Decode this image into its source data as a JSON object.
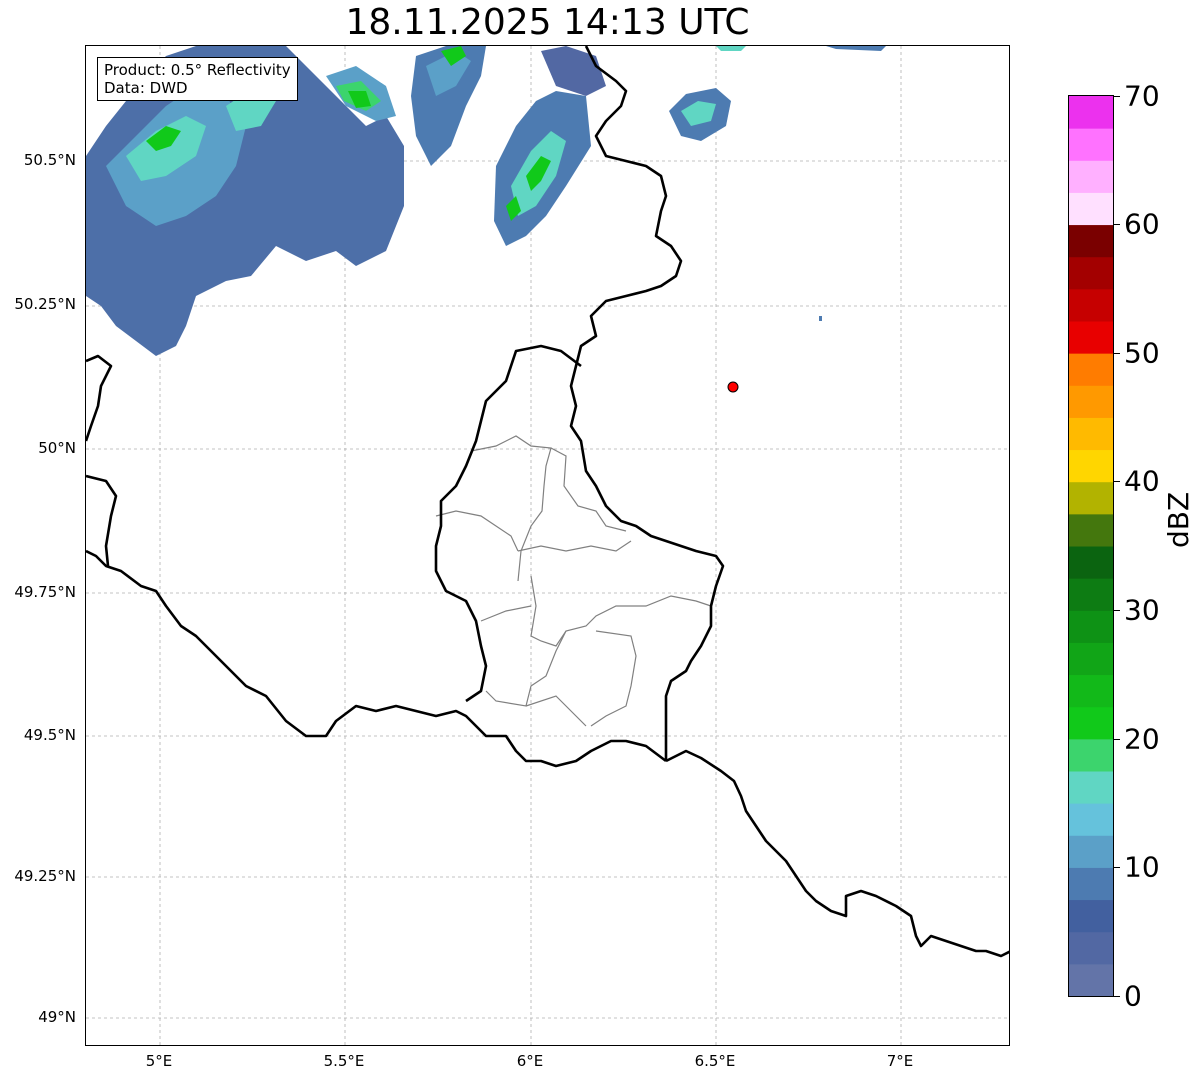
{
  "title": "18.11.2025 14:13 UTC",
  "info": {
    "line1": "Product: 0.5° Reflectivity",
    "line2": "Data: DWD"
  },
  "map": {
    "lat_labels": [
      "50.5°N",
      "50.25°N",
      "50°N",
      "49.75°N",
      "49.5°N",
      "49.25°N",
      "49°N"
    ],
    "lon_labels": [
      "5°E",
      "5.5°E",
      "6°E",
      "6.5°E",
      "7°E"
    ],
    "radar_site_color": "#ff0000"
  },
  "colorbar": {
    "label": "dBZ",
    "range": [
      0,
      70
    ],
    "tick_labels": [
      "0",
      "10",
      "20",
      "30",
      "40",
      "50",
      "60",
      "70"
    ],
    "colors": [
      "#6374a8",
      "#5268a3",
      "#42609f",
      "#4d7bb1",
      "#5ba0c8",
      "#65c2dc",
      "#60d6c3",
      "#3cd46d",
      "#11c91a",
      "#12b919",
      "#11a517",
      "#0e9215",
      "#0d7c13",
      "#0b6410",
      "#44770d",
      "#b2b300",
      "#ffd600",
      "#ffba00",
      "#ff9900",
      "#ff7c00",
      "#e80000",
      "#c60000",
      "#a30000",
      "#7a0000",
      "#ffe0ff",
      "#ffb0ff",
      "#ff72ff",
      "#ec31ee"
    ]
  }
}
